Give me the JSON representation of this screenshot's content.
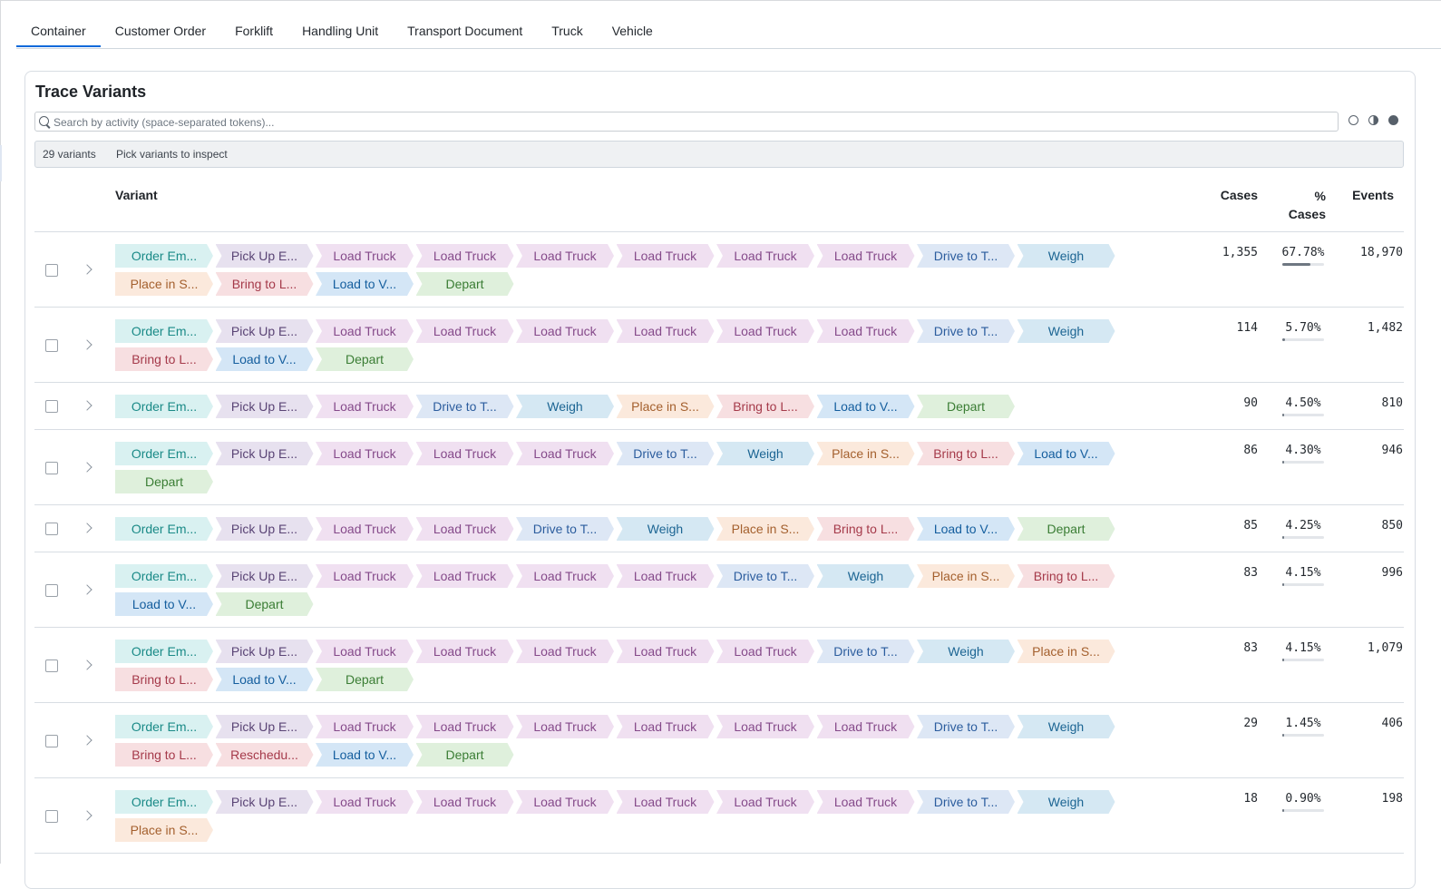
{
  "tabs": [
    "Container",
    "Customer Order",
    "Forklift",
    "Handling Unit",
    "Transport Document",
    "Truck",
    "Vehicle"
  ],
  "active_tab": 0,
  "panel": {
    "title": "Trace Variants",
    "search_placeholder": "Search by activity (space-separated tokens)...",
    "variant_count": "29 variants",
    "hint": "Pick variants to inspect"
  },
  "columns": {
    "variant": "Variant",
    "cases": "Cases",
    "pct_line1": "%",
    "pct_line2": "Cases",
    "events": "Events"
  },
  "activity_colors": {
    "Order Em...": {
      "bg": "#d9f1f1",
      "fg": "#1a8a87"
    },
    "Pick Up E...": {
      "bg": "#e7e1ef",
      "fg": "#5a4475"
    },
    "Load Truck": {
      "bg": "#f0e0f1",
      "fg": "#854a8a"
    },
    "Drive to T...": {
      "bg": "#dde7f5",
      "fg": "#2c5d9e"
    },
    "Weigh": {
      "bg": "#d5e8f3",
      "fg": "#1c6593"
    },
    "Place in S...": {
      "bg": "#fbe9dc",
      "fg": "#a4602e"
    },
    "Bring to L...": {
      "bg": "#f7dfe1",
      "fg": "#a53a4a"
    },
    "Load to V...": {
      "bg": "#d4e6f6",
      "fg": "#145e9e"
    },
    "Depart": {
      "bg": "#dff0dc",
      "fg": "#3a7d34"
    },
    "Reschedu...": {
      "bg": "#f7dfe1",
      "fg": "#a53a4a"
    }
  },
  "variants": [
    {
      "activities": [
        "Order Em...",
        "Pick Up E...",
        "Load Truck",
        "Load Truck",
        "Load Truck",
        "Load Truck",
        "Load Truck",
        "Load Truck",
        "Drive to T...",
        "Weigh",
        "Place in S...",
        "Bring to L...",
        "Load to V...",
        "Depart"
      ],
      "cases": "1,355",
      "pct": "67.78%",
      "pct_value": 0.6778,
      "events": "18,970"
    },
    {
      "activities": [
        "Order Em...",
        "Pick Up E...",
        "Load Truck",
        "Load Truck",
        "Load Truck",
        "Load Truck",
        "Load Truck",
        "Load Truck",
        "Drive to T...",
        "Weigh",
        "Bring to L...",
        "Load to V...",
        "Depart"
      ],
      "cases": "114",
      "pct": "5.70%",
      "pct_value": 0.057,
      "events": "1,482"
    },
    {
      "activities": [
        "Order Em...",
        "Pick Up E...",
        "Load Truck",
        "Drive to T...",
        "Weigh",
        "Place in S...",
        "Bring to L...",
        "Load to V...",
        "Depart"
      ],
      "cases": "90",
      "pct": "4.50%",
      "pct_value": 0.045,
      "events": "810"
    },
    {
      "activities": [
        "Order Em...",
        "Pick Up E...",
        "Load Truck",
        "Load Truck",
        "Load Truck",
        "Drive to T...",
        "Weigh",
        "Place in S...",
        "Bring to L...",
        "Load to V...",
        "Depart"
      ],
      "cases": "86",
      "pct": "4.30%",
      "pct_value": 0.043,
      "events": "946"
    },
    {
      "activities": [
        "Order Em...",
        "Pick Up E...",
        "Load Truck",
        "Load Truck",
        "Drive to T...",
        "Weigh",
        "Place in S...",
        "Bring to L...",
        "Load to V...",
        "Depart"
      ],
      "cases": "85",
      "pct": "4.25%",
      "pct_value": 0.0425,
      "events": "850"
    },
    {
      "activities": [
        "Order Em...",
        "Pick Up E...",
        "Load Truck",
        "Load Truck",
        "Load Truck",
        "Load Truck",
        "Drive to T...",
        "Weigh",
        "Place in S...",
        "Bring to L...",
        "Load to V...",
        "Depart"
      ],
      "cases": "83",
      "pct": "4.15%",
      "pct_value": 0.0415,
      "events": "996"
    },
    {
      "activities": [
        "Order Em...",
        "Pick Up E...",
        "Load Truck",
        "Load Truck",
        "Load Truck",
        "Load Truck",
        "Load Truck",
        "Drive to T...",
        "Weigh",
        "Place in S...",
        "Bring to L...",
        "Load to V...",
        "Depart"
      ],
      "cases": "83",
      "pct": "4.15%",
      "pct_value": 0.0415,
      "events": "1,079"
    },
    {
      "activities": [
        "Order Em...",
        "Pick Up E...",
        "Load Truck",
        "Load Truck",
        "Load Truck",
        "Load Truck",
        "Load Truck",
        "Load Truck",
        "Drive to T...",
        "Weigh",
        "Bring to L...",
        "Reschedu...",
        "Load to V...",
        "Depart"
      ],
      "cases": "29",
      "pct": "1.45%",
      "pct_value": 0.0145,
      "events": "406"
    },
    {
      "activities": [
        "Order Em...",
        "Pick Up E...",
        "Load Truck",
        "Load Truck",
        "Load Truck",
        "Load Truck",
        "Load Truck",
        "Load Truck",
        "Drive to T...",
        "Weigh",
        "Place in S..."
      ],
      "cases": "18",
      "pct": "0.90%",
      "pct_value": 0.009,
      "events": "198"
    }
  ]
}
